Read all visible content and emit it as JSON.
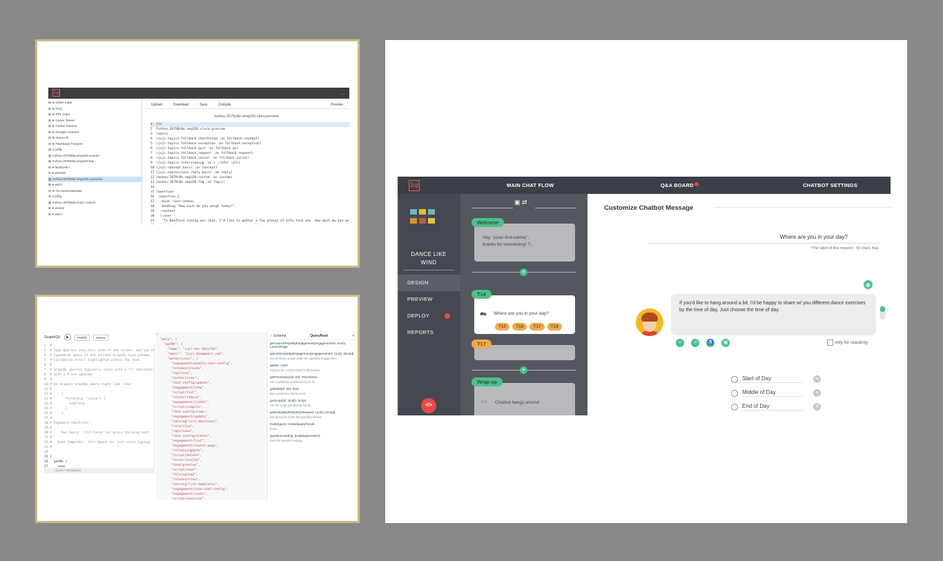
{
  "editor": {
    "logo": "Juji",
    "menu": "...",
    "tree": [
      "⊞ ⊕ Order Labs",
      "⊞ ⊕ FAQ",
      "⊞ ⊕ PPL reqer",
      "⊞ ⊕ Carter Tomes",
      "⊞ ⊕ Carten Garens",
      "⊞ ⊕ Genglin Chester",
      "⊞ ⊕ maruo-fit",
      "⊟ ⊕ Filehhaed Ponesrtt",
      "     ▤ Config",
      "     ▤ mzhou-2079e8a.smg326.custom",
      "     ▤ mzhou-2079e8a.smg326.faq",
      "   ⊞ ● facebook-l",
      "   ⊟ ● preview",
      "        ▤ mzhou-2079c8e.smg326.c.preview",
      "   ⊞ ● web-l",
      "⊟ ⊕ rsu.swow.taaooaw",
      "     ⚙ Config",
      "     ▤ mzhou-2079e8a.smg7.custom",
      "   ⊞ ● private",
      "   ⊞ ● web-l"
    ],
    "toolbar": {
      "upload": "Upload",
      "download": "Download",
      "save": "Save",
      "compile": "Compile",
      "preview": "Preview"
    },
    "filename": "mzhou-2079c8e.smg326.clara.preview",
    "code": [
      "1  [[s",
      "2  Fathea.20790c8e.smg326.clara.preview",
      "3  (macro",
      "4  (juji.topics.fallback.chatthread :as fallback.chatbot)",
      "5  (juji.topics.fallback.exception :as fallback.exception)",
      "6  (juji.topics.fallback.quit :as fallback.qu)",
      "7  (juji.topics.fallback.request :as fallback.request)",
      "8  (juji.topics.fallback.social :as fallback.social)",
      "9  (juji.topics.interviewing :as i :refer :all)",
      "10 (juji.concept.basic :as concept)",
      "11 (juji.expressions.reply-basic :as reply)",
      "12 (mzhou-2079c8e.smg326.custom :as custom)",
      "13 (mzhou-2079c8e.smg326.faq :as faq)]]",
      "14",
      "15 (question",
      "16  (question_1",
      "17   :kind :user-ended,",
      "18   :heading \"How much do you weigh today?\",",
      "19   :content",
      "20   [:user",
      "21    \"To Reaftore ending our chat, I'd like to gather a few pieces of info form you. How much do you weigh today?\"]",
      "22   [:text \"Not just me got your weight information, Me\"]",
      "23   :measurable true}",
      "24  {:text \"sprinkle l like to collect your weight data ok\"},",
      "25   :measurable true}"
    ]
  },
  "graphiql": {
    "title": "GraphiQL",
    "play": "▶",
    "prettify": "Prettify",
    "history": "History",
    "query": [
      "2  #",
      "3  # Type queries into this side of the screen, and you wi",
      "4  # typeahead aware of the current GraphQL type schema",
      "5  # validation errors highlighted within the text.",
      "6  #",
      "7  # GraphQL queries typically start with a \"{\" character",
      "8  # with a # are ignored.",
      "9  #",
      "10 # An example GraphQL query might look like:",
      "11 #",
      "12 #     {",
      "13 #       field(arg: \"value\") {",
      "14 #         subField",
      "15 #       }",
      "16 #     }",
      "17 #",
      "18 # Keyboard shortcuts:",
      "19 #",
      "20 #     Run Query:  Ctrl-Enter (or press the play butt",
      "21 #",
      "22 #   Auto Complete:  Ctrl-Space (or just start typing)",
      "23 #",
      "24",
      "25 {",
      "26   getMe {",
      "27     name",
      "28     email",
      "29     permissions",
      "30   }",
      "31 }"
    ],
    "variables_label": "QUERY VARIABLES",
    "result": [
      "{",
      "  \"data\": {",
      "    \"getMe\": {",
      "      \"name\": \"juji-dev-9d2c7a5\",",
      "      \"email\": \"juji-dev@gmail.com\",",
      "      \"permissions\": [",
      "        \"engagement/modify-chat-config\",",
      "        \"release/create\",",
      "        \"repl/use\",",
      "        \"tester/view\",",
      "        \"chat-config/update\",",
      "        \"engagement/view\",",
      "        \"script/list\",",
      "        \"tester/remove\",",
      "        \"engagement/create\",",
      "        \"script/compile\",",
      "        \"chat-config/view\",",
      "        \"engagement/update\",",
      "        \"catalog/list-questions\",",
      "        \"role/view\",",
      "        \"repl/save\",",
      "        \"chat-config/create\",",
      "        \"engagement/list\",",
      "        \"engagement/launch-page\",",
      "        \"release/update\",",
      "        \"script/delete\",",
      "        \"tester/invite\",",
      "        \"chat/preview\",",
      "        \"script/save\",",
      "        \"file/upload\",",
      "        \"release/view\",",
      "        \"catalog/list-templates\",",
      "        \"engagement/view-chat-config\",",
      "        \"engagement/stats\",",
      "        \"script/generate\",",
      "        \"engagement/create-chat-config\"",
      "      ]"
    ],
    "docs_back": "‹ Schema",
    "docs_title": "QueryRoot",
    "docs_close": "✕",
    "docs": [
      {
        "name": "getLaunchPageByEngagement(engagementId: ULID): LaunchPage",
        "desc": ""
      },
      {
        "name": "getListScriptsByEngagement(engagementId: ULID): [Script]",
        "desc": "Get all library scripts under the specified engagement."
      },
      {
        "name": "getMe: User!",
        "desc": "Returns the current viewer's information."
      },
      {
        "name": "getPermission(id: Int): Permission",
        "desc": "Get a particular permission by its ID."
      },
      {
        "name": "getRole(id: Int): Role",
        "desc": "Get a particular role by its ID."
      },
      {
        "name": "getScript(id: ULID): Script",
        "desc": "Get the script specified by the ID"
      },
      {
        "name": "getScriptsByRelease(releaseId: ULID): [Script]",
        "desc": "Get all scripts under the specified release."
      },
      {
        "name": "invite(query: InvitedquaryResult",
        "desc": "Invite"
      },
      {
        "name": "questionCatalog: [CatalogQuestion]",
        "desc": "Gets the question catalog."
      }
    ]
  },
  "chatbot": {
    "logo": "Juji",
    "nav": {
      "main": "MAIN CHAT FLOW",
      "qa": "Q&A BOARD",
      "settings": "CHATBOT SETTINGS"
    },
    "bot_name": "DANCE LIKE WIND",
    "menu": {
      "design": "DESIGN",
      "preview": "PREVIEW",
      "deploy": "DEPLOY",
      "reports": "REPORTS"
    },
    "code_button": "</>",
    "flow": {
      "tools": "▣ ⇄",
      "welcome_tag": "Welcome",
      "welcome_text": "Hey `(user-first-name)`, thanks for connecting! ?..",
      "t14_tag": "T14",
      "t14_text": "Where are you in your day?",
      "t14_chips": [
        "T15",
        "T16",
        "T17",
        "T18"
      ],
      "t17_tag": "T17",
      "wrapup_tag": "Wrap-up",
      "wrapup_text": "Chatbot hangs around"
    },
    "panel": {
      "heading": "Customize Chatbot Message",
      "question": "Where are you in your day?",
      "hint": "*The label of this request - 50 chars max",
      "message": "If you'd like to hang around a bit, I'd be happy to share w/ you different dance exercises by the time of day. Just choose the time of day.",
      "reask": "only for reasking",
      "options": [
        "Start of Day",
        "Middle of Day",
        "End of Day"
      ]
    },
    "colors": {
      "accent": "#4bc08b",
      "chip": "#f0a94d",
      "alert": "#e8494a"
    }
  }
}
